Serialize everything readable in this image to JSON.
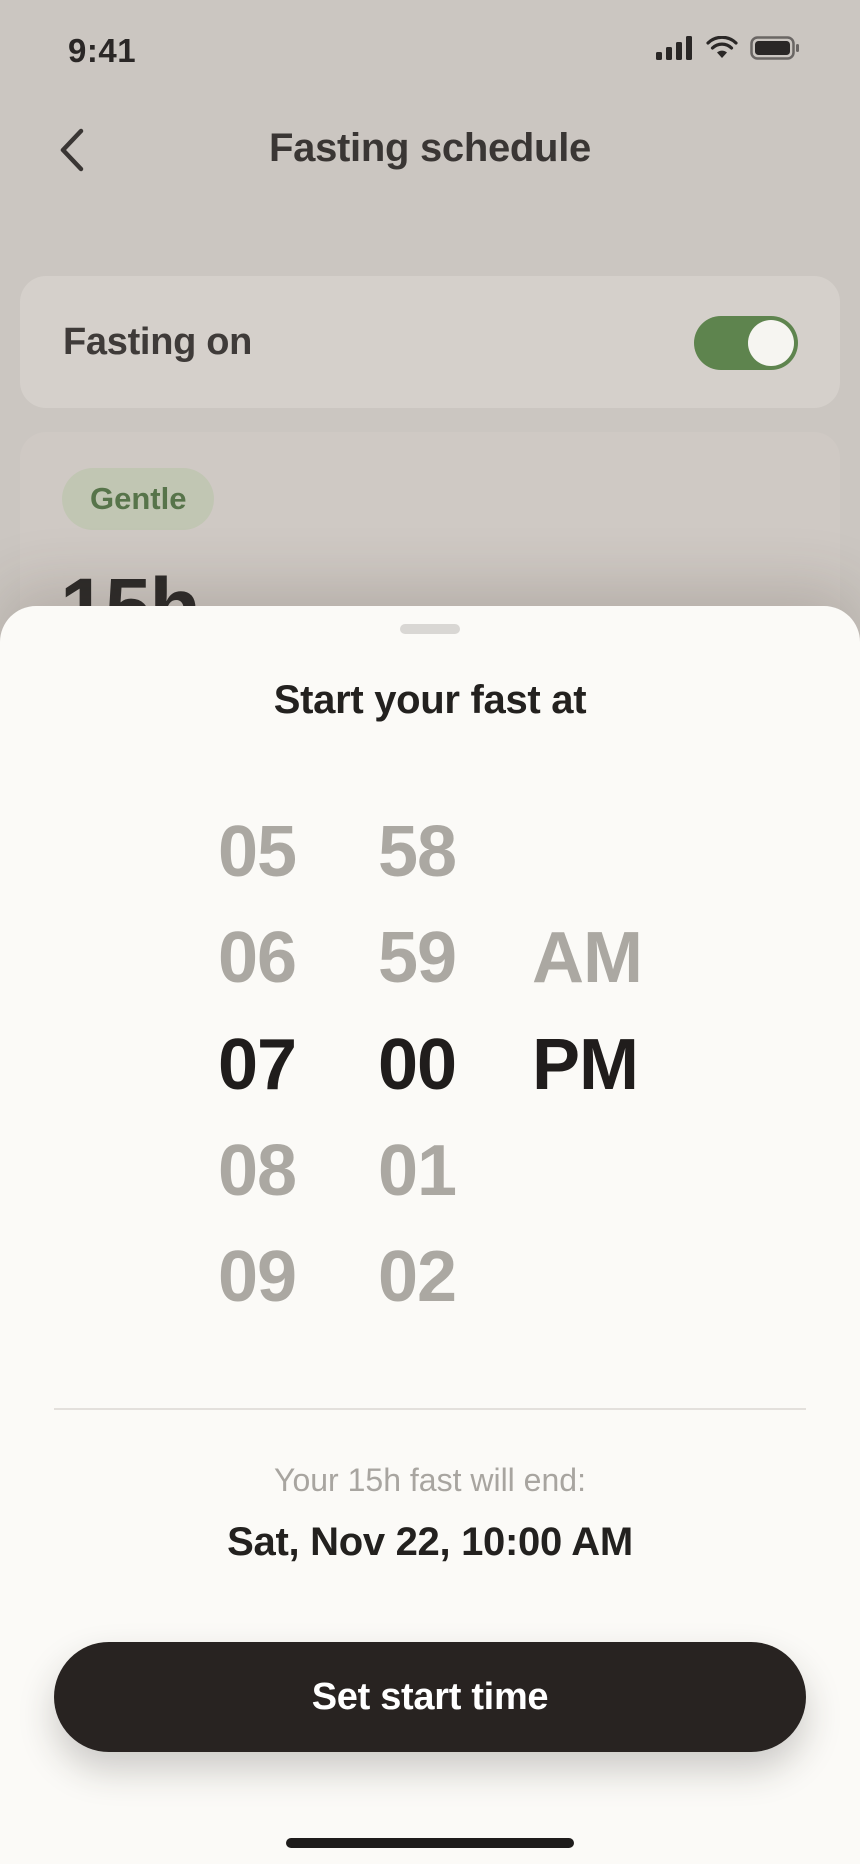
{
  "status_bar": {
    "time": "9:41",
    "icons": [
      "signal-icon",
      "wifi-icon",
      "battery-icon"
    ]
  },
  "header": {
    "title": "Fasting schedule",
    "back_icon": "chevron-left-icon"
  },
  "toggle_card": {
    "label": "Fasting on",
    "enabled": true
  },
  "plan_card": {
    "badge": "Gentle",
    "hours": "15h"
  },
  "sheet": {
    "title": "Start your fast at",
    "picker": {
      "hours": [
        "05",
        "06",
        "07",
        "08",
        "09"
      ],
      "minutes": [
        "58",
        "59",
        "00",
        "01",
        "02"
      ],
      "periods": [
        "AM",
        "PM"
      ],
      "selected": {
        "hour": "07",
        "minute": "00",
        "period": "PM"
      }
    },
    "end_label": "Your 15h fast will end:",
    "end_value": "Sat, Nov 22, 10:00 AM",
    "cta": "Set start time"
  },
  "colors": {
    "accent_green": "#5e844e",
    "cta_bg": "#282321",
    "sheet_bg": "#fbfaf7",
    "backdrop": "#cbc6c1"
  }
}
